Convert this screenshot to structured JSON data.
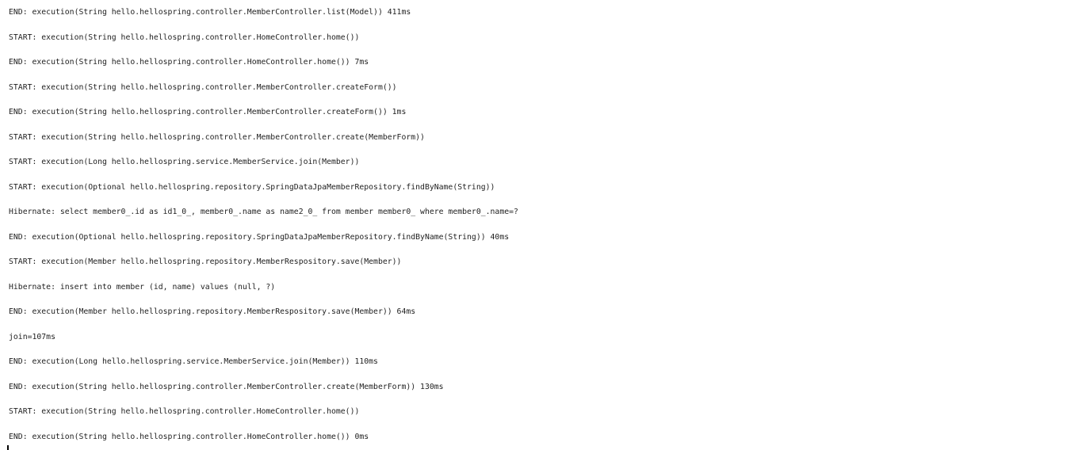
{
  "console": {
    "lines": [
      "END: execution(String hello.hellospring.controller.MemberController.list(Model)) 411ms",
      "START: execution(String hello.hellospring.controller.HomeController.home())",
      "END: execution(String hello.hellospring.controller.HomeController.home()) 7ms",
      "START: execution(String hello.hellospring.controller.MemberController.createForm())",
      "END: execution(String hello.hellospring.controller.MemberController.createForm()) 1ms",
      "START: execution(String hello.hellospring.controller.MemberController.create(MemberForm))",
      "START: execution(Long hello.hellospring.service.MemberService.join(Member))",
      "START: execution(Optional hello.hellospring.repository.SpringDataJpaMemberRepository.findByName(String))",
      "Hibernate: select member0_.id as id1_0_, member0_.name as name2_0_ from member member0_ where member0_.name=?",
      "END: execution(Optional hello.hellospring.repository.SpringDataJpaMemberRepository.findByName(String)) 40ms",
      "START: execution(Member hello.hellospring.repository.MemberRespository.save(Member))",
      "Hibernate: insert into member (id, name) values (null, ?)",
      "END: execution(Member hello.hellospring.repository.MemberRespository.save(Member)) 64ms",
      "join=107ms",
      "END: execution(Long hello.hellospring.service.MemberService.join(Member)) 110ms",
      "END: execution(String hello.hellospring.controller.MemberController.create(MemberForm)) 130ms",
      "START: execution(String hello.hellospring.controller.HomeController.home())",
      "END: execution(String hello.hellospring.controller.HomeController.home()) 0ms"
    ]
  }
}
